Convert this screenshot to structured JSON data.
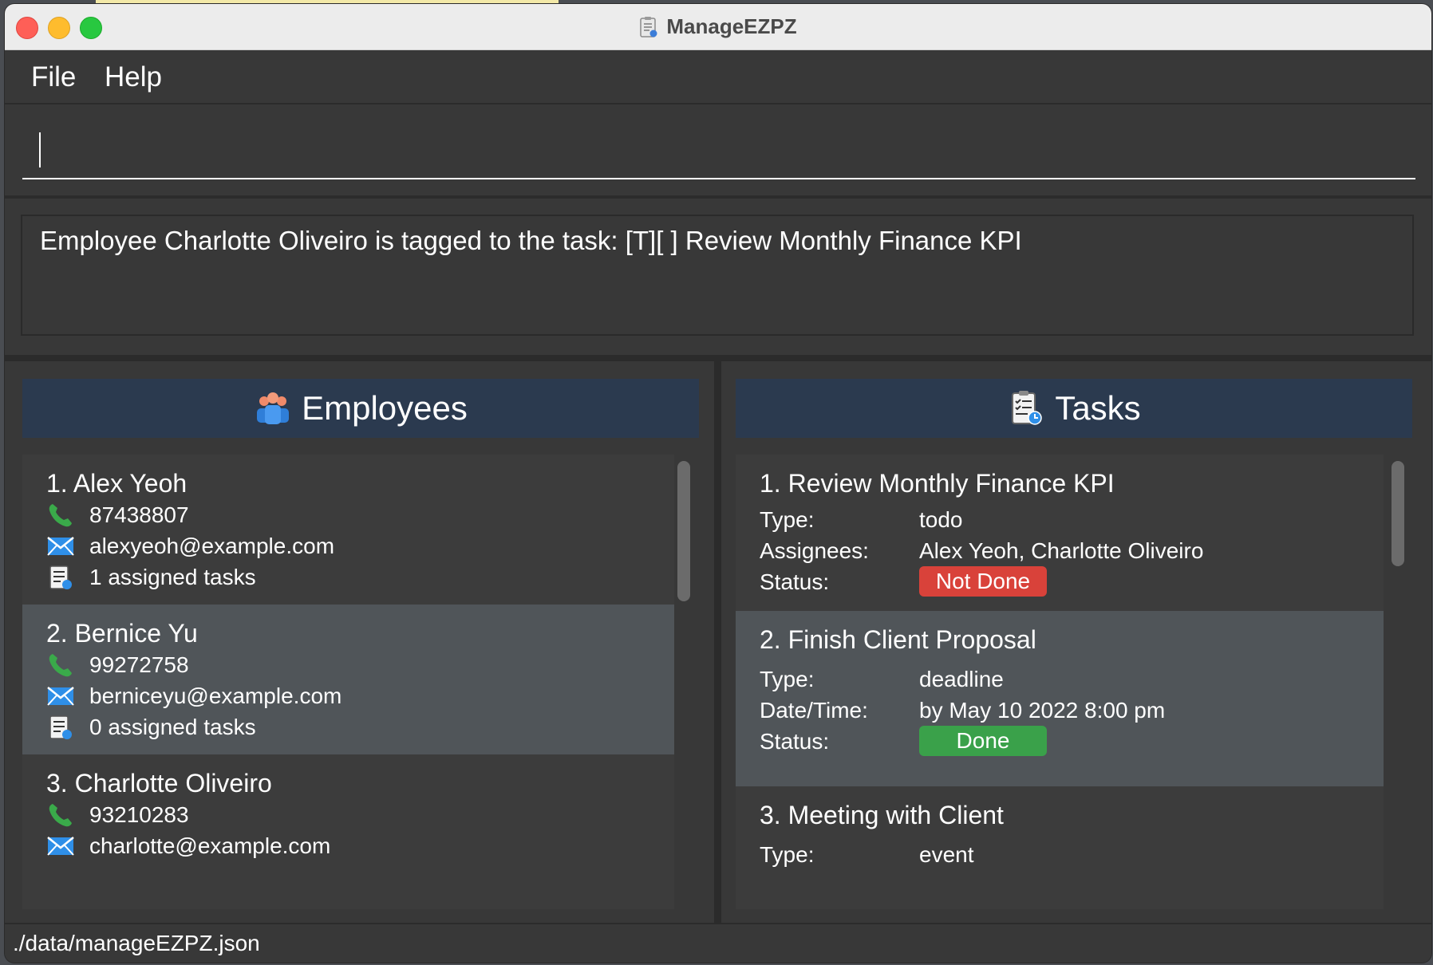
{
  "window": {
    "title": "ManageEZPZ"
  },
  "menu": {
    "file": "File",
    "help": "Help"
  },
  "command": {
    "value": "",
    "placeholder": ""
  },
  "result": {
    "message": "Employee Charlotte Oliveiro is tagged to the task: [T][ ] Review Monthly Finance KPI"
  },
  "employees": {
    "title": "Employees",
    "items": [
      {
        "index": "1.",
        "name": "Alex Yeoh",
        "phone": "87438807",
        "email": "alexyeoh@example.com",
        "tasks": "1 assigned tasks"
      },
      {
        "index": "2.",
        "name": "Bernice Yu",
        "phone": "99272758",
        "email": "berniceyu@example.com",
        "tasks": "0 assigned tasks"
      },
      {
        "index": "3.",
        "name": "Charlotte Oliveiro",
        "phone": "93210283",
        "email": "charlotte@example.com",
        "tasks": ""
      }
    ]
  },
  "tasks": {
    "title": "Tasks",
    "labels": {
      "type": "Type:",
      "assignees": "Assignees:",
      "datetime": "Date/Time:",
      "status": "Status:"
    },
    "items": [
      {
        "index": "1.",
        "name": "Review Monthly Finance KPI",
        "type": "todo",
        "assignees": "Alex Yeoh, Charlotte Oliveiro",
        "status": "Not Done"
      },
      {
        "index": "2.",
        "name": "Finish Client Proposal",
        "type": "deadline",
        "datetime": "by May 10 2022 8:00 pm",
        "status": "Done"
      },
      {
        "index": "3.",
        "name": "Meeting with Client",
        "type": "event"
      }
    ]
  },
  "statusbar": {
    "path": "./data/manageEZPZ.json"
  },
  "colors": {
    "not_done": "#d9423a",
    "done": "#3aa14a",
    "header_bg": "#2b3a4f"
  },
  "icons": [
    "app-icon",
    "employees-icon",
    "tasks-icon",
    "phone-icon",
    "email-icon",
    "assigned-tasks-icon"
  ]
}
